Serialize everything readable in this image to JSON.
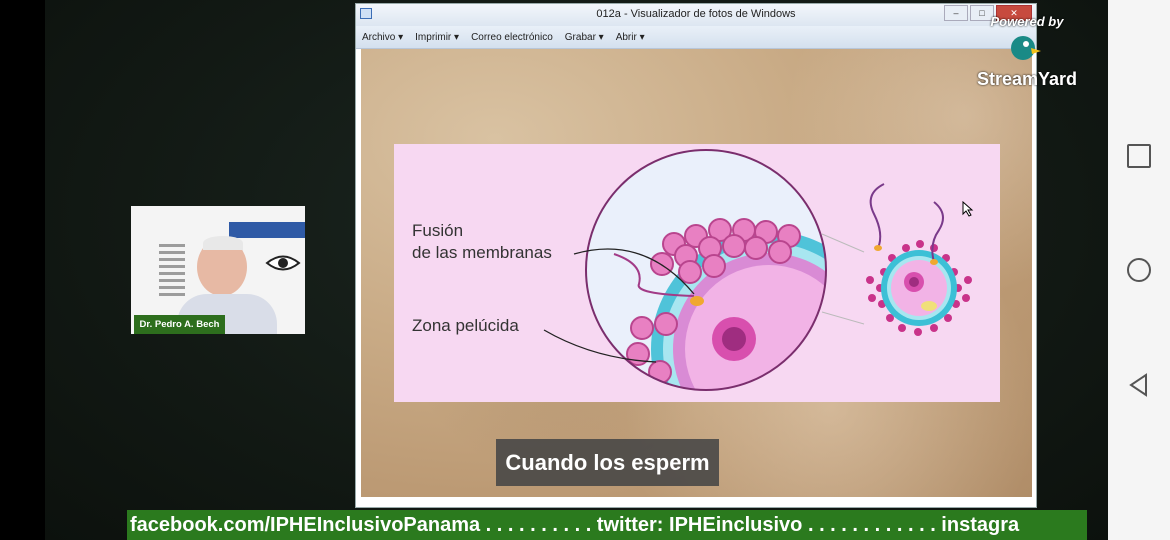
{
  "window": {
    "title": "012a - Visualizador de fotos de Windows",
    "controls": [
      "–",
      "□",
      "✕"
    ],
    "menu": [
      "Archivo ▾",
      "Imprimir ▾",
      "Correo electrónico",
      "Grabar ▾",
      "Abrir ▾"
    ]
  },
  "diagram": {
    "label_fusion_line1": "Fusión",
    "label_fusion_line2": "de las membranas",
    "label_zona": "Zona pelúcida"
  },
  "caption": "Cuando los esperm",
  "streamyard": {
    "powered": "Powered by",
    "name": "StreamYard"
  },
  "camera": {
    "name": "Dr. Pedro A. Bech"
  },
  "ticker": "facebook.com/IPHEInclusivoPanama . . . . . . . . . . twitter: IPHEinclusivo . . . . . . . . . . . . instagra",
  "colors": {
    "ticker_bg": "#2b7a1e",
    "name_tag": "#2d6e1d",
    "diagram_bg": "#f7d8f2",
    "zona": "#6fd1df",
    "cell": "#cc4f95"
  }
}
